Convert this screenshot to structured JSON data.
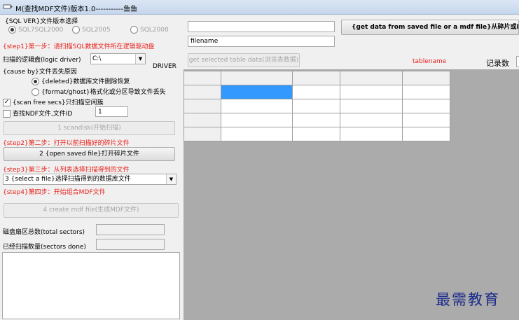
{
  "window": {
    "title": "M(查找MDF文件)版本1.0-----------鱼鱼"
  },
  "sql_version": {
    "label": "{SQL VER}文件版本选择",
    "options": [
      "SQL7SQL2000",
      "SQL2005",
      "SQL2008"
    ]
  },
  "step1": {
    "text": "{step1}第一步：请扫描SQL数据文件所在逻辑驱动盘",
    "drive_label": "扫描的逻辑盘(logic driver)",
    "drive_value": "C:\\",
    "driver_caption": "DRIVER",
    "cause_label": "{cause by}文件丢失原因",
    "cause_options": [
      "{deleted}数据库文件删除恢复",
      "{format/ghost}格式化或分区导致文件丢失"
    ],
    "scan_free_label": "{scan free secs}只扫描空闲簇",
    "find_ndf_label": "查找NDF文件,文件ID",
    "ndf_id": "1",
    "scandisk_button": "1 scandisk(开始扫描)"
  },
  "step2": {
    "text": "{step2}第二步：打开以前扫描好的碎片文件",
    "open_button": "2 {open saved file}打开碎片文件"
  },
  "step3": {
    "text": "{step3}第三步：从列表选择扫描得到的文件",
    "select_value": "3 {select a file}选择扫描得到的数据库文件"
  },
  "step4": {
    "text": "{step4}第四步：开始组合MDF文件",
    "create_button": "4 create mdf file(生成MDF文件)"
  },
  "stats": {
    "total_sectors_label": "磁盘扇区总数(total sectors)",
    "sectors_done_label": "已经扫描数量(sectors done)"
  },
  "right_panel": {
    "filename_value": "filename",
    "get_data_button": "{get data from saved file or a mdf file}从碎片或MD",
    "get_table_button": "get selected table data(浏览表数据)",
    "tablename_label": "tablename",
    "records_label": "记录数"
  },
  "watermark": "最需教育",
  "colors": {
    "accent_red": "#e8201a",
    "selected_cell": "#3399ff"
  }
}
